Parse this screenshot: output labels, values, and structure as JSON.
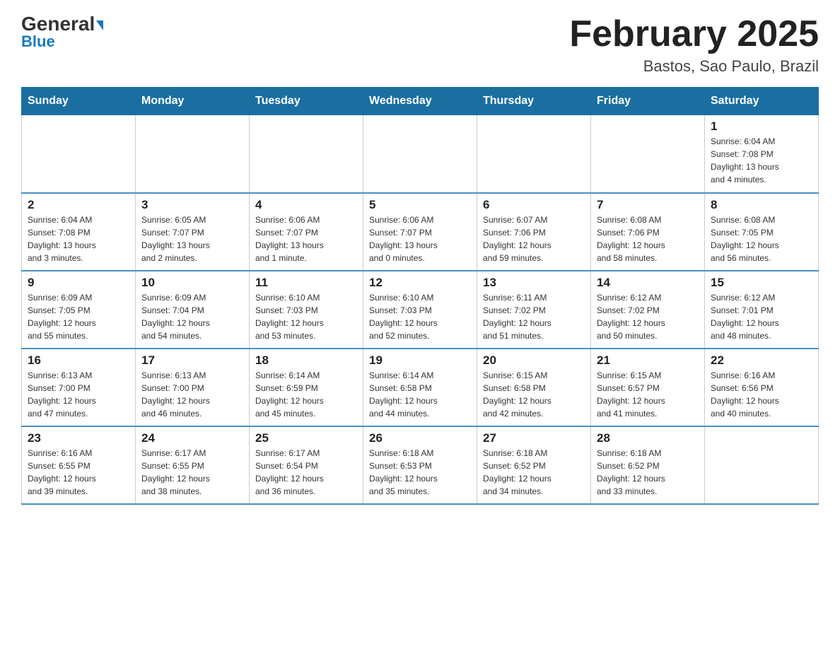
{
  "header": {
    "logo_general": "General",
    "logo_blue": "Blue",
    "month_title": "February 2025",
    "location": "Bastos, Sao Paulo, Brazil"
  },
  "weekdays": [
    "Sunday",
    "Monday",
    "Tuesday",
    "Wednesday",
    "Thursday",
    "Friday",
    "Saturday"
  ],
  "weeks": [
    [
      {
        "day": "",
        "info": ""
      },
      {
        "day": "",
        "info": ""
      },
      {
        "day": "",
        "info": ""
      },
      {
        "day": "",
        "info": ""
      },
      {
        "day": "",
        "info": ""
      },
      {
        "day": "",
        "info": ""
      },
      {
        "day": "1",
        "info": "Sunrise: 6:04 AM\nSunset: 7:08 PM\nDaylight: 13 hours\nand 4 minutes."
      }
    ],
    [
      {
        "day": "2",
        "info": "Sunrise: 6:04 AM\nSunset: 7:08 PM\nDaylight: 13 hours\nand 3 minutes."
      },
      {
        "day": "3",
        "info": "Sunrise: 6:05 AM\nSunset: 7:07 PM\nDaylight: 13 hours\nand 2 minutes."
      },
      {
        "day": "4",
        "info": "Sunrise: 6:06 AM\nSunset: 7:07 PM\nDaylight: 13 hours\nand 1 minute."
      },
      {
        "day": "5",
        "info": "Sunrise: 6:06 AM\nSunset: 7:07 PM\nDaylight: 13 hours\nand 0 minutes."
      },
      {
        "day": "6",
        "info": "Sunrise: 6:07 AM\nSunset: 7:06 PM\nDaylight: 12 hours\nand 59 minutes."
      },
      {
        "day": "7",
        "info": "Sunrise: 6:08 AM\nSunset: 7:06 PM\nDaylight: 12 hours\nand 58 minutes."
      },
      {
        "day": "8",
        "info": "Sunrise: 6:08 AM\nSunset: 7:05 PM\nDaylight: 12 hours\nand 56 minutes."
      }
    ],
    [
      {
        "day": "9",
        "info": "Sunrise: 6:09 AM\nSunset: 7:05 PM\nDaylight: 12 hours\nand 55 minutes."
      },
      {
        "day": "10",
        "info": "Sunrise: 6:09 AM\nSunset: 7:04 PM\nDaylight: 12 hours\nand 54 minutes."
      },
      {
        "day": "11",
        "info": "Sunrise: 6:10 AM\nSunset: 7:03 PM\nDaylight: 12 hours\nand 53 minutes."
      },
      {
        "day": "12",
        "info": "Sunrise: 6:10 AM\nSunset: 7:03 PM\nDaylight: 12 hours\nand 52 minutes."
      },
      {
        "day": "13",
        "info": "Sunrise: 6:11 AM\nSunset: 7:02 PM\nDaylight: 12 hours\nand 51 minutes."
      },
      {
        "day": "14",
        "info": "Sunrise: 6:12 AM\nSunset: 7:02 PM\nDaylight: 12 hours\nand 50 minutes."
      },
      {
        "day": "15",
        "info": "Sunrise: 6:12 AM\nSunset: 7:01 PM\nDaylight: 12 hours\nand 48 minutes."
      }
    ],
    [
      {
        "day": "16",
        "info": "Sunrise: 6:13 AM\nSunset: 7:00 PM\nDaylight: 12 hours\nand 47 minutes."
      },
      {
        "day": "17",
        "info": "Sunrise: 6:13 AM\nSunset: 7:00 PM\nDaylight: 12 hours\nand 46 minutes."
      },
      {
        "day": "18",
        "info": "Sunrise: 6:14 AM\nSunset: 6:59 PM\nDaylight: 12 hours\nand 45 minutes."
      },
      {
        "day": "19",
        "info": "Sunrise: 6:14 AM\nSunset: 6:58 PM\nDaylight: 12 hours\nand 44 minutes."
      },
      {
        "day": "20",
        "info": "Sunrise: 6:15 AM\nSunset: 6:58 PM\nDaylight: 12 hours\nand 42 minutes."
      },
      {
        "day": "21",
        "info": "Sunrise: 6:15 AM\nSunset: 6:57 PM\nDaylight: 12 hours\nand 41 minutes."
      },
      {
        "day": "22",
        "info": "Sunrise: 6:16 AM\nSunset: 6:56 PM\nDaylight: 12 hours\nand 40 minutes."
      }
    ],
    [
      {
        "day": "23",
        "info": "Sunrise: 6:16 AM\nSunset: 6:55 PM\nDaylight: 12 hours\nand 39 minutes."
      },
      {
        "day": "24",
        "info": "Sunrise: 6:17 AM\nSunset: 6:55 PM\nDaylight: 12 hours\nand 38 minutes."
      },
      {
        "day": "25",
        "info": "Sunrise: 6:17 AM\nSunset: 6:54 PM\nDaylight: 12 hours\nand 36 minutes."
      },
      {
        "day": "26",
        "info": "Sunrise: 6:18 AM\nSunset: 6:53 PM\nDaylight: 12 hours\nand 35 minutes."
      },
      {
        "day": "27",
        "info": "Sunrise: 6:18 AM\nSunset: 6:52 PM\nDaylight: 12 hours\nand 34 minutes."
      },
      {
        "day": "28",
        "info": "Sunrise: 6:18 AM\nSunset: 6:52 PM\nDaylight: 12 hours\nand 33 minutes."
      },
      {
        "day": "",
        "info": ""
      }
    ]
  ]
}
